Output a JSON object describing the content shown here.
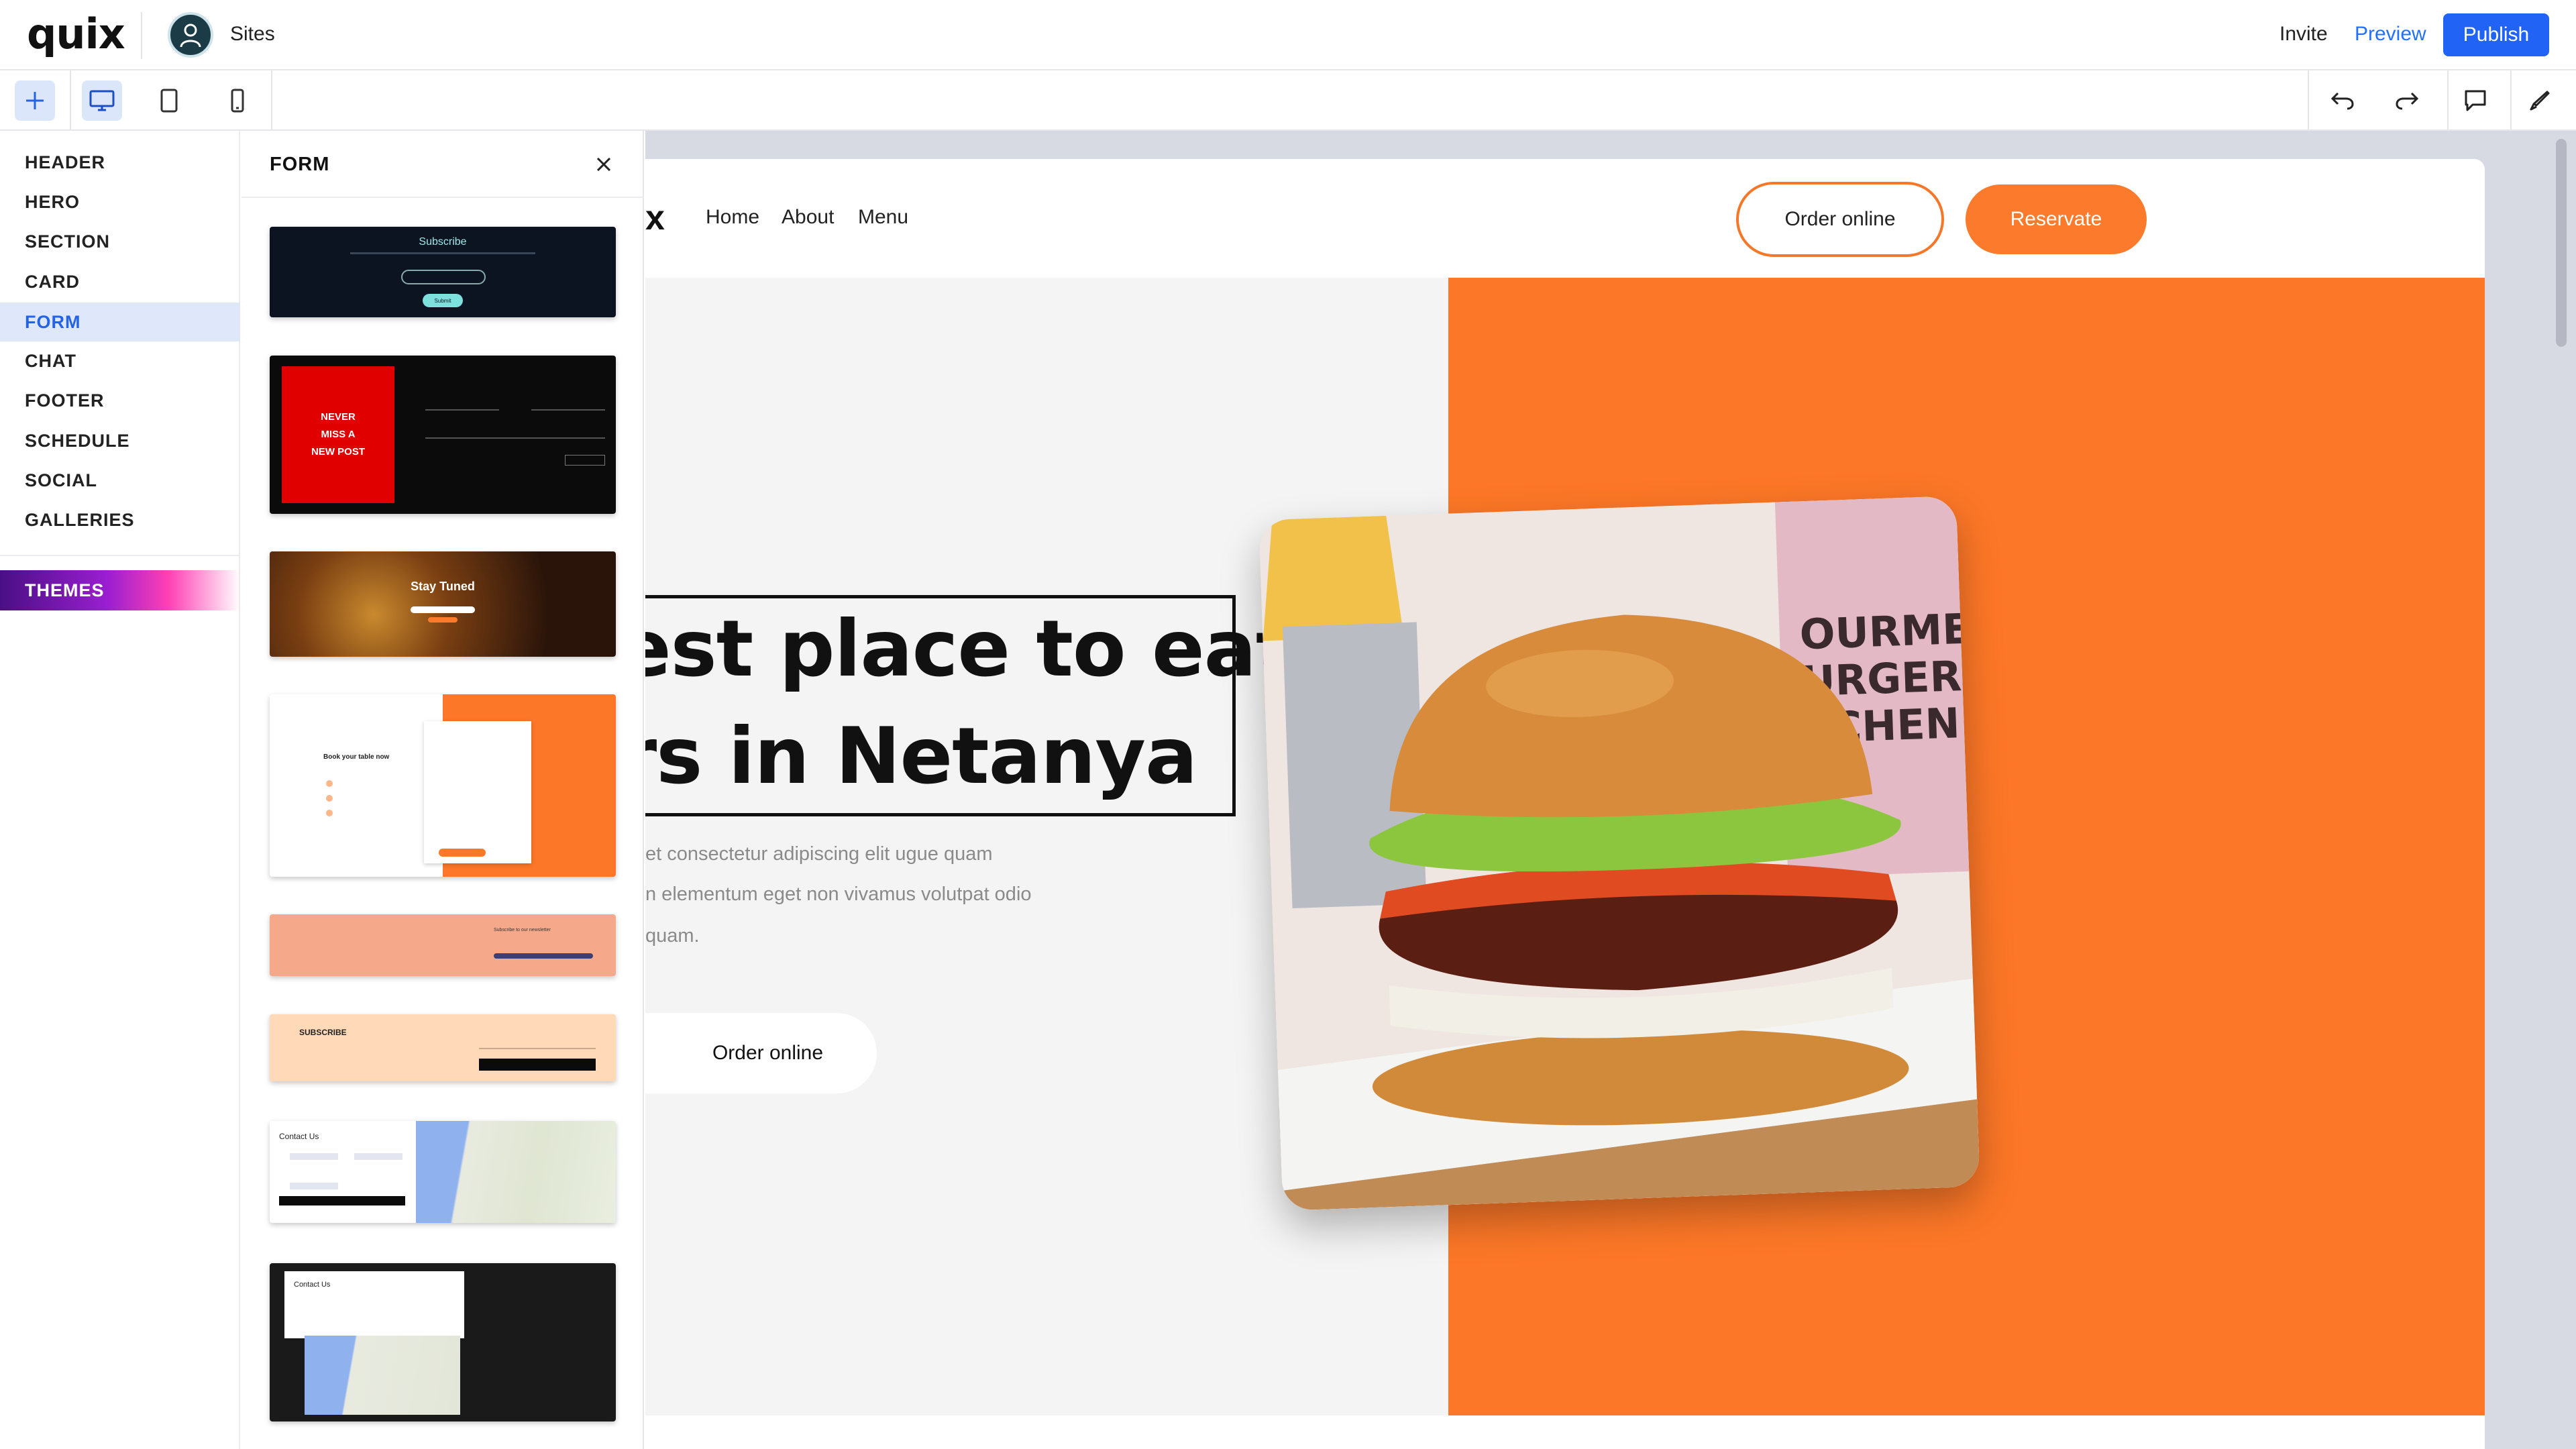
{
  "app": {
    "logo": "quix",
    "sites_label": "Sites"
  },
  "topbar": {
    "invite": "Invite",
    "preview": "Preview",
    "publish": "Publish"
  },
  "left_nav": {
    "items": [
      "HEADER",
      "HERO",
      "SECTION",
      "CARD",
      "FORM",
      "CHAT",
      "FOOTER",
      "SCHEDULE",
      "SOCIAL",
      "GALLERIES"
    ],
    "active": "FORM",
    "themes": "THEMES"
  },
  "panel": {
    "title": "FORM",
    "templates": [
      {
        "subscribe_title": "Subscribe",
        "subscribe_button": "Submit"
      },
      {
        "promo_text": "NEVER MISS A NEW POST"
      },
      {
        "heading": "Stay Tuned"
      },
      {
        "heading": "Book your table now"
      },
      {
        "heading": "Subscribe to our newsletter"
      },
      {
        "heading": "SUBSCRIBE"
      },
      {
        "heading": "Contact Us"
      },
      {
        "heading": "Contact Us"
      }
    ]
  },
  "site": {
    "logo": "x",
    "nav_links": [
      "Home",
      "About",
      "Menu"
    ],
    "order_online": "Order online",
    "reservate": "Reservate",
    "headline_line1": "est place to eat",
    "headline_line2": "rs in Netanya",
    "paragraph_lines": [
      "et consectetur adipiscing elit ugue quam",
      "n elementum eget non vivamus volutpat odio",
      "quam."
    ],
    "order_online_hero": "Order online",
    "photo_alt": "GOURMET BURGER KITCHEN"
  },
  "colors": {
    "accent": "#fc7727",
    "primary": "#2063f5",
    "active_nav": "#2463e6"
  }
}
